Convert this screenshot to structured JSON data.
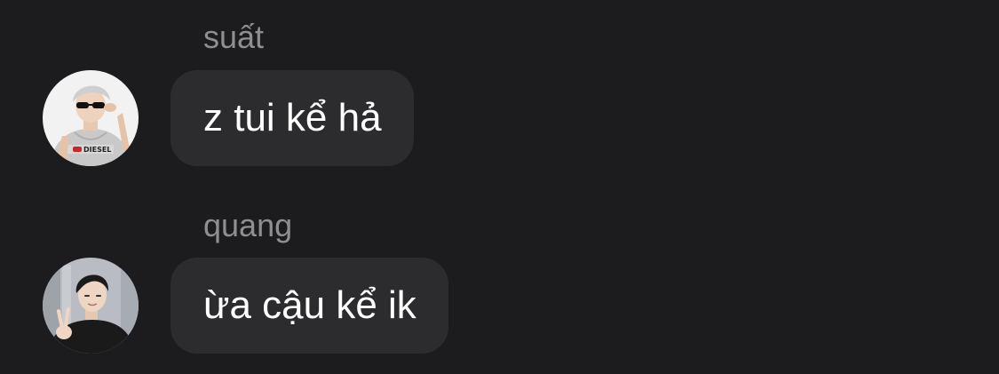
{
  "messages": [
    {
      "sender": "suất",
      "text": "z tui kể hả",
      "avatar_icon": "person-with-sunglasses-avatar"
    },
    {
      "sender": "quang",
      "text": "ừa cậu kể ik",
      "avatar_icon": "person-peace-sign-avatar"
    }
  ],
  "colors": {
    "background": "#1c1c1e",
    "bubble": "#2c2c2e",
    "sender_name": "#8e8e93",
    "message_text": "#ffffff"
  }
}
